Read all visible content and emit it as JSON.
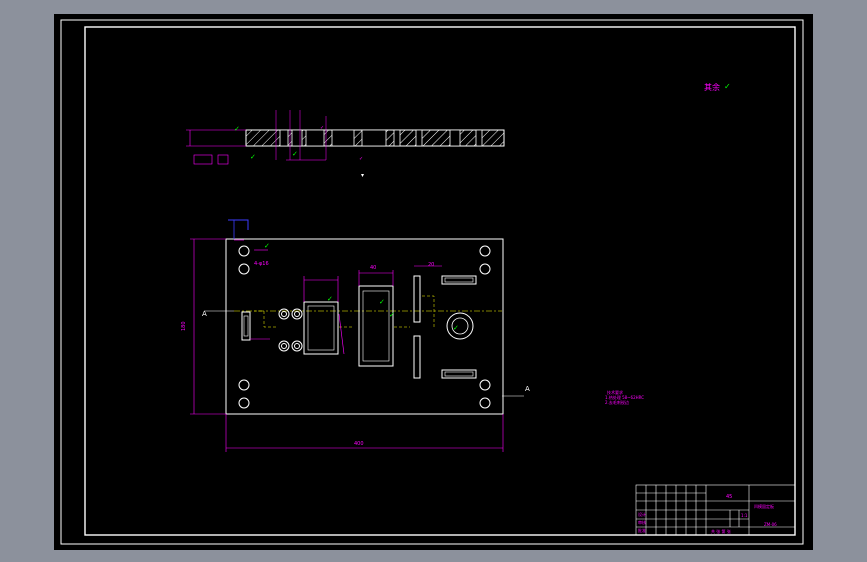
{
  "tech_requirements_heading": "技术要求",
  "tech_requirements_lines": [
    "1.热处理 58~62HRC",
    "2.去毛刺锐边"
  ],
  "roughness_note": "其余",
  "dimensions": {
    "overall_length": "400",
    "overall_width": "180",
    "hole_dim": "4-φ16",
    "pocket_dim": "40",
    "slot_dim": "20"
  },
  "section_markers": {
    "left": "A",
    "right": "A"
  },
  "title_block": {
    "part_name": "凹模固定板",
    "material": "45",
    "drawing_no": "ZM-06",
    "scale": "1:1",
    "sheet": "共 张 第 张",
    "designer_label": "设计",
    "checker_label": "审核",
    "approver_label": "批准"
  },
  "colors": {
    "magenta": "#ff00ff",
    "white": "#ffffff",
    "green": "#00ff00",
    "yellow": "#ffff00",
    "blue": "#3c3cff"
  }
}
